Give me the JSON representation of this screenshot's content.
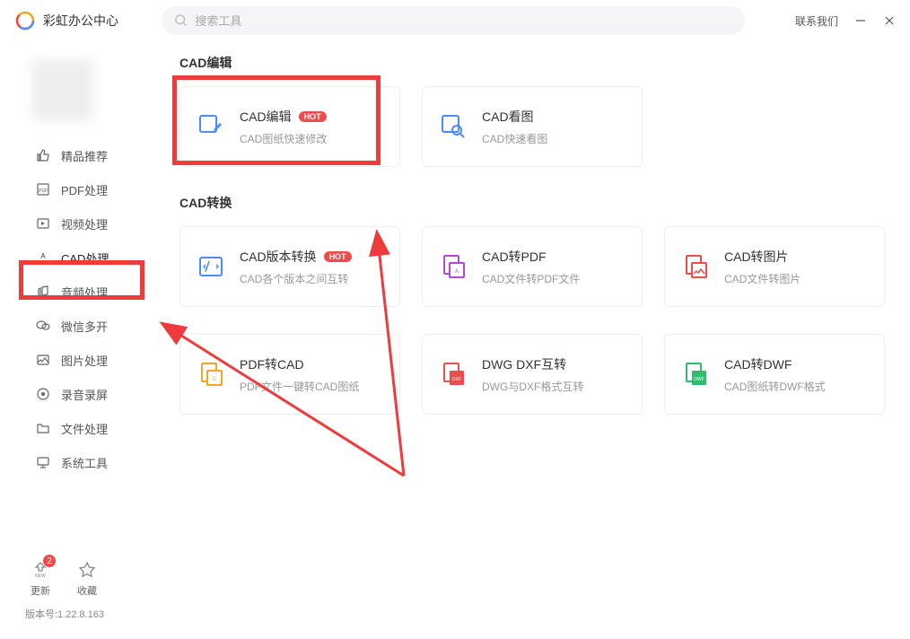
{
  "header": {
    "app_title": "彩虹办公中心",
    "search_placeholder": "搜索工具",
    "contact": "联系我们"
  },
  "sidebar": {
    "items": [
      {
        "label": "精品推荐",
        "icon": "thumb-up"
      },
      {
        "label": "PDF处理",
        "icon": "pdf"
      },
      {
        "label": "视频处理",
        "icon": "video"
      },
      {
        "label": "CAD处理",
        "icon": "cad",
        "active": true
      },
      {
        "label": "音频处理",
        "icon": "audio"
      },
      {
        "label": "微信多开",
        "icon": "wechat"
      },
      {
        "label": "图片处理",
        "icon": "image"
      },
      {
        "label": "录音录屏",
        "icon": "record"
      },
      {
        "label": "文件处理",
        "icon": "file"
      },
      {
        "label": "系统工具",
        "icon": "system"
      }
    ],
    "bottom": {
      "update_label": "更新",
      "update_badge": "2",
      "favorite_label": "收藏",
      "version": "版本号:1.22.8.163"
    }
  },
  "sections": [
    {
      "title": "CAD编辑",
      "cards": [
        {
          "title": "CAD编辑",
          "desc": "CAD图纸快速修改",
          "hot": true,
          "icon_color": "#4b8bff"
        },
        {
          "title": "CAD看图",
          "desc": "CAD快速看图",
          "hot": false,
          "icon_color": "#4b8bff"
        }
      ]
    },
    {
      "title": "CAD转换",
      "cards": [
        {
          "title": "CAD版本转换",
          "desc": "CAD各个版本之间互转",
          "hot": true,
          "icon_color": "#4b8bff"
        },
        {
          "title": "CAD转PDF",
          "desc": "CAD文件转PDF文件",
          "hot": false,
          "icon_color": "#b946d6"
        },
        {
          "title": "CAD转图片",
          "desc": "CAD文件转图片",
          "hot": false,
          "icon_color": "#ee4b4b"
        },
        {
          "title": "PDF转CAD",
          "desc": "PDF文件一键转CAD图纸",
          "hot": false,
          "icon_color": "#f5a623"
        },
        {
          "title": "DWG DXF互转",
          "desc": "DWG与DXF格式互转",
          "hot": false,
          "icon_color": "#ee4b4b"
        },
        {
          "title": "CAD转DWF",
          "desc": "CAD图纸转DWF格式",
          "hot": false,
          "icon_color": "#2dbd6e"
        }
      ]
    }
  ],
  "hot_label": "HOT"
}
